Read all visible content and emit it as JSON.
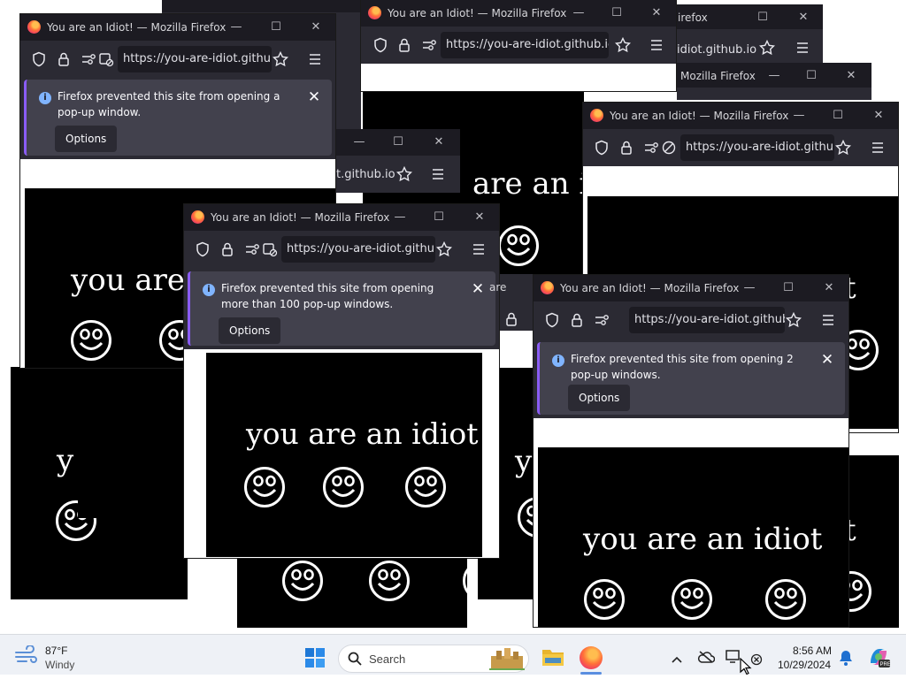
{
  "page_title": "You are an Idiot! — Mozilla Firefox",
  "win_title": "You are an Idiot! — Mozilla Firefox",
  "url": "https://you-are-idiot.github.io/",
  "url_frag_1": "idiot.github.io",
  "url_frag_2": "t.github.io",
  "frag_firefox": "irefox",
  "frag_mozilla": "Mozilla Firefox",
  "frag_ope": "ope",
  "frag_are": "are",
  "frag_are_an": "are an",
  "frag_are_an_i": "are an i",
  "frag_you_are": "you are",
  "frag_y": "y",
  "frag_t": "t",
  "idiot_text": "you are an idiot",
  "notif_1": "Firefox prevented this site from opening a pop-up window.",
  "notif_2": "Firefox prevented this site from opening more than 100 pop-up windows.",
  "notif_3": "Firefox prevented this site from opening 2 pop-up windows.",
  "options_label": "Options",
  "icons": {
    "window": [
      "firefox-icon",
      "minimize-icon",
      "maximize-icon",
      "close-icon"
    ],
    "navbar": [
      "shield-icon",
      "lock-icon",
      "permissions-icon",
      "star-icon",
      "menu-icon"
    ],
    "taskbar": [
      "weather-icon",
      "start-icon",
      "search-icon",
      "file-explorer-icon",
      "firefox-icon",
      "chevron-up-icon",
      "onedrive-icon",
      "network-icon",
      "bell-icon",
      "copilot-icon"
    ]
  },
  "taskbar": {
    "temperature": "87°F",
    "weather": "Windy",
    "search_placeholder": "Search",
    "time": "8:56 AM",
    "date": "10/29/2024"
  },
  "colors": {
    "titlebar": "#1c1b22",
    "toolbar": "#2b2a33",
    "notification": "#42414d",
    "info_icon": "#80b4ff",
    "taskbar": "#eef1f6"
  }
}
